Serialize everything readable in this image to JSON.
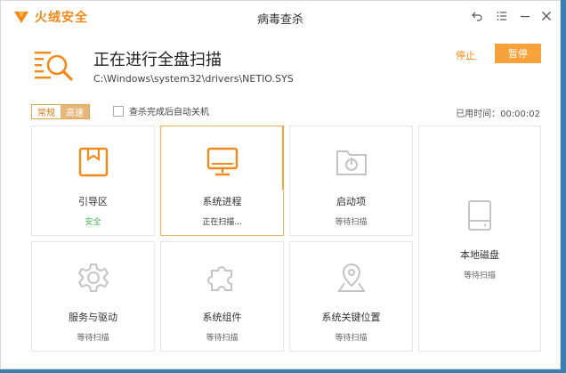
{
  "app": {
    "brand": "火绒安全",
    "window_title": "病毒查杀"
  },
  "window_controls": {
    "back": "back-icon",
    "menu": "menu-icon",
    "minimize": "minimize-icon",
    "close": "close-icon"
  },
  "scan": {
    "title": "正在进行全盘扫描",
    "current_path": "C:\\Windows\\system32\\drivers\\NETIO.SYS",
    "stop_label": "停止",
    "pause_label": "暂停"
  },
  "options": {
    "modes": [
      "常规",
      "高速"
    ],
    "selected_mode": "常规",
    "auto_shutdown_label": "查杀完成后自动关机",
    "auto_shutdown_checked": false,
    "elapsed": "已用时间：00:00:02"
  },
  "cards": [
    {
      "title": "引导区",
      "status": "安全",
      "icon": "boot-sector-icon"
    },
    {
      "title": "系统进程",
      "status": "正在扫描...",
      "icon": "monitor-icon"
    },
    {
      "title": "启动项",
      "status": "等待扫描",
      "icon": "startup-folder-icon"
    },
    {
      "title": "服务与驱动",
      "status": "等待扫描",
      "icon": "gear-icon"
    },
    {
      "title": "系统组件",
      "status": "等待扫描",
      "icon": "puzzle-icon"
    },
    {
      "title": "系统关键位置",
      "status": "等待扫描",
      "icon": "location-pin-icon"
    },
    {
      "title": "本地磁盘",
      "status": "等待扫描",
      "icon": "disk-icon"
    }
  ],
  "colors": {
    "accent": "#f08a1c",
    "button": "#f7a23b",
    "safe": "#4caf50",
    "inactive_icon": "#bfbfbf"
  }
}
